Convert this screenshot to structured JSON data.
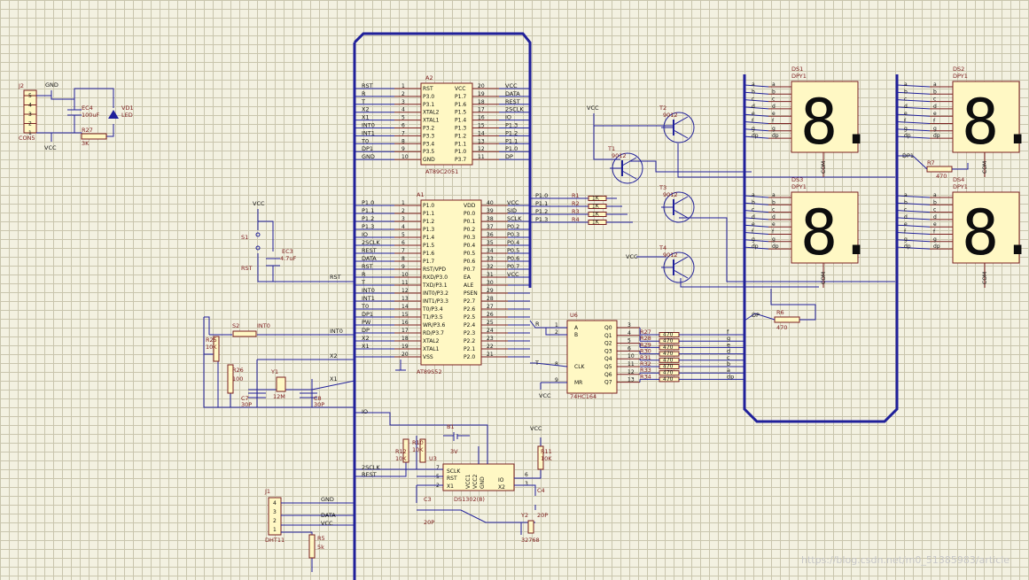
{
  "mcu2": {
    "ref": "A2",
    "part": "AT89C2051",
    "left_pins": [
      "RST",
      "P3.0",
      "P3.1",
      "XTAL2",
      "XTAL1",
      "P3.2",
      "P3.3",
      "P3.4",
      "P3.5",
      "GND"
    ],
    "left_nums": [
      "1",
      "2",
      "3",
      "4",
      "5",
      "6",
      "7",
      "8",
      "9",
      "10"
    ],
    "right_pins": [
      "VCC",
      "P1.7",
      "P1.6",
      "P1.5",
      "P1.4",
      "P1.3",
      "P1.2",
      "P1.1",
      "P1.0",
      "P3.7"
    ],
    "right_nums": [
      "20",
      "19",
      "18",
      "17",
      "16",
      "15",
      "14",
      "13",
      "12",
      "11"
    ],
    "left_nets": [
      "RST",
      "R",
      "T",
      "X2",
      "X1",
      "INT0",
      "INT1",
      "T0",
      "DP1",
      "GND"
    ],
    "right_nets": [
      "VCC",
      "DATA",
      "REST",
      "2SCLK",
      "IO",
      "P1.3",
      "P1.2",
      "P1.1",
      "P1.0",
      "DP"
    ]
  },
  "mcu1": {
    "ref": "A1",
    "part": "AT89S52",
    "left_pins": [
      "P1.0",
      "P1.1",
      "P1.2",
      "P1.3",
      "P1.4",
      "P1.5",
      "P1.6",
      "P1.7",
      "RST/VPD",
      "RXD/P3.0",
      "TXD/P3.1",
      "INT0/P3.2",
      "INT1/P3.3",
      "T0/P3.4",
      "T1/P3.5",
      "WR/P3.6",
      "RD/P3.7",
      "XTAL2",
      "XTAL1",
      "VSS"
    ],
    "left_nums": [
      "1",
      "2",
      "3",
      "4",
      "5",
      "6",
      "7",
      "8",
      "9",
      "10",
      "11",
      "12",
      "13",
      "14",
      "15",
      "16",
      "17",
      "18",
      "19",
      "20"
    ],
    "right_pins": [
      "VDD",
      "P0.0",
      "P0.1",
      "P0.2",
      "P0.3",
      "P0.4",
      "P0.5",
      "P0.6",
      "P0.7",
      "EA",
      "ALE",
      "PSEN",
      "P2.7",
      "P2.6",
      "P2.5",
      "P2.4",
      "P2.3",
      "P2.2",
      "P2.1",
      "P2.0"
    ],
    "right_nums": [
      "40",
      "39",
      "38",
      "37",
      "36",
      "35",
      "34",
      "33",
      "32",
      "31",
      "30",
      "29",
      "28",
      "27",
      "26",
      "25",
      "24",
      "23",
      "22",
      "21"
    ],
    "left_nets": [
      "P1.0",
      "P1.1",
      "P1.2",
      "P1.3",
      "IO",
      "2SCLK",
      "REST",
      "DATA",
      "RST",
      "R",
      "T",
      "INT0",
      "INT1",
      "T0",
      "DP1",
      "PW",
      "DP",
      "X2",
      "X1",
      ""
    ],
    "right_nets": [
      "VCC",
      "SID",
      "SCLK",
      "P0.2",
      "P0.3",
      "P0.4",
      "P0.5",
      "P0.6",
      "P0.7",
      "VCC",
      "",
      "",
      "",
      "",
      "",
      "",
      "",
      "",
      "",
      ""
    ]
  },
  "shift": {
    "ref": "U6",
    "part": "74HC164",
    "pins_left": [
      "A",
      "B",
      "CLK",
      "MR"
    ],
    "nums_left": [
      "1",
      "2",
      "8",
      "9"
    ],
    "pins_right": [
      "Q0",
      "Q1",
      "Q2",
      "Q3",
      "Q4",
      "Q5",
      "Q6",
      "Q7"
    ],
    "nums_right": [
      "3",
      "4",
      "5",
      "6",
      "10",
      "11",
      "12",
      "13"
    ],
    "nets_left": [
      "R",
      "T",
      "VCC"
    ],
    "res_labels": [
      "R27",
      "R28",
      "R29",
      "R30",
      "R31",
      "R32",
      "R33",
      "R34"
    ],
    "res_value": "470",
    "seg_labels": [
      "f",
      "g",
      "e",
      "d",
      "c",
      "b",
      "a",
      "dp"
    ]
  },
  "rtc": {
    "ref": "U3",
    "part": "DS1302(8)",
    "pins": [
      "SCLK",
      "RST",
      "X1",
      "VCC1",
      "VCC2",
      "GND",
      "IO",
      "X2"
    ],
    "nums": [
      "7",
      "5",
      "2",
      "8",
      "1",
      "4",
      "6",
      "3"
    ],
    "battery": "B1",
    "battery_v": "3V",
    "r10": "R10",
    "r10v": "10K",
    "r12": "R12",
    "r12v": "10K",
    "r11": "R11",
    "r11v": "10K",
    "c3": "C3",
    "c3v": "20P",
    "c4": "C4",
    "c4v": "20P",
    "y2": "Y2",
    "y2v": "32768",
    "nets": [
      "IO",
      "2SCLK",
      "REST",
      "VCC"
    ]
  },
  "power": {
    "j2": "J2",
    "j2n": "CON5",
    "gnd": "GND",
    "vcc": "VCC",
    "ec4": "EC4",
    "ec4v": "100uF",
    "vd1": "VD1",
    "led": "LED",
    "r27": "R27",
    "r27v": "3K",
    "pins": [
      "5",
      "4",
      "3",
      "2",
      "1"
    ]
  },
  "reset": {
    "vcc": "VCC",
    "s1": "S1",
    "rst": "RST",
    "ec3": "EC3",
    "ec3v": "4.7uF",
    "net": "RST"
  },
  "int": {
    "s2": "S2",
    "net": "INT0",
    "r25": "R25",
    "r25v": "10K",
    "r26": "R26",
    "r26v": "100"
  },
  "xtal": {
    "y1": "Y1",
    "y1v": "12M",
    "c7": "C7",
    "c7v": "30P",
    "c8": "C8",
    "c8v": "30P",
    "x2": "X2",
    "x1": "X1"
  },
  "sensor": {
    "j1": "J1",
    "name": "DHT11",
    "pins": [
      "4",
      "3",
      "2",
      "1"
    ],
    "nets": [
      "GND",
      "DATA",
      "VCC"
    ],
    "r5": "R5",
    "r5v": "5k"
  },
  "drivers": {
    "vcc": "VCC",
    "r_labels": [
      "R1",
      "R2",
      "R3",
      "R4"
    ],
    "r_value": "1K",
    "t_labels": [
      "T1",
      "T2",
      "T3",
      "T4"
    ],
    "t_part": "9012",
    "nets": [
      "P1.0",
      "P1.1",
      "P1.2",
      "P1.3"
    ]
  },
  "displays": [
    {
      "ref": "DS1",
      "part": "DPY1"
    },
    {
      "ref": "DS2",
      "part": "DPY1"
    },
    {
      "ref": "DS3",
      "part": "DPY1"
    },
    {
      "ref": "DS4",
      "part": "DPY1"
    }
  ],
  "disp_pins": [
    "a",
    "b",
    "c",
    "d",
    "e",
    "f",
    "g",
    "dp"
  ],
  "disp_common": "COM",
  "disp_glyph": "8.",
  "dp_net": "DP",
  "dp1_net": "DP1",
  "r6": "R6",
  "r6v": "470",
  "r7": "R7",
  "r7v": "470",
  "watermark": "https://blog.csdn.net/m0_51385983/article"
}
